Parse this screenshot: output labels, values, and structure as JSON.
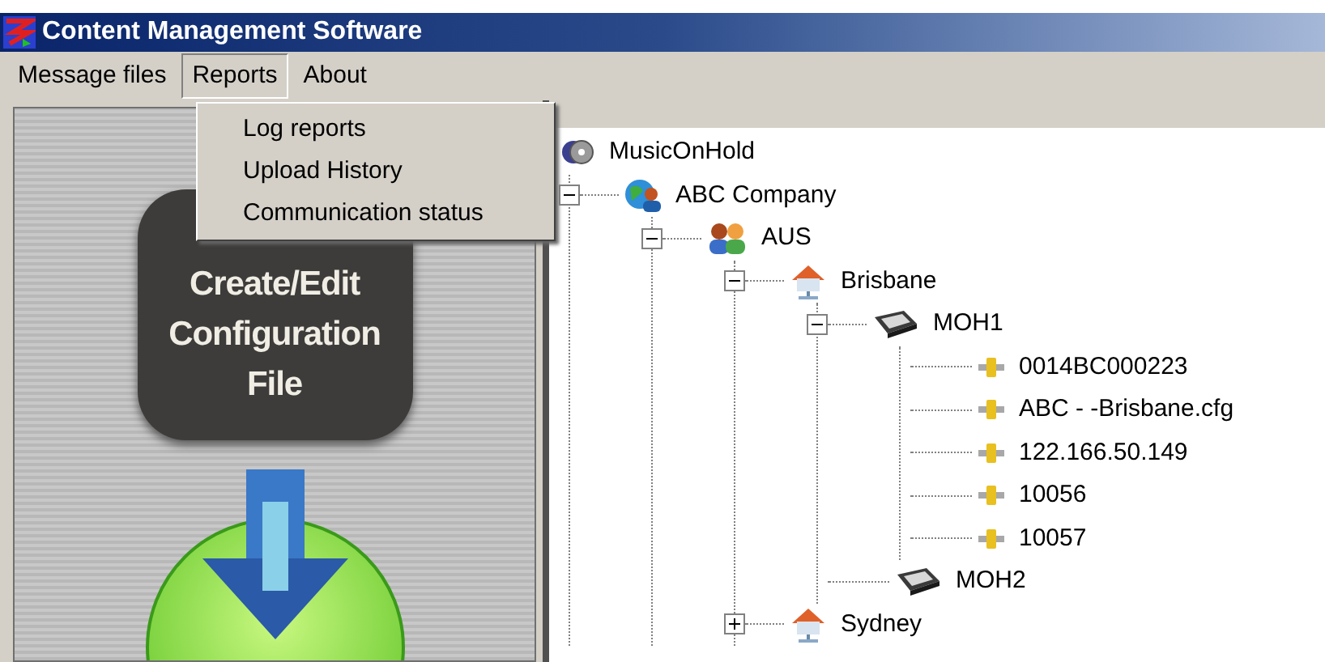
{
  "window": {
    "title": "Content Management Software"
  },
  "menu": [
    {
      "label": "Message files",
      "selected": false
    },
    {
      "label": "Reports",
      "selected": true,
      "items": [
        "Log reports",
        "Upload History",
        "Communication status"
      ]
    },
    {
      "label": "About",
      "selected": false
    }
  ],
  "sidebar": {
    "create_button": {
      "lines": [
        "Create/Edit",
        "Configuration",
        "File"
      ]
    }
  },
  "tree": {
    "label": "MusicOnHold",
    "kind": "root",
    "children": [
      {
        "label": "ABC Company",
        "kind": "company",
        "expanded": true,
        "children": [
          {
            "label": "AUS",
            "kind": "group",
            "expanded": true,
            "children": [
              {
                "label": "Brisbane",
                "kind": "site",
                "expanded": true,
                "children": [
                  {
                    "label": "MOH1",
                    "kind": "device",
                    "expanded": true,
                    "children": [
                      {
                        "label": "0014BC000223",
                        "kind": "property"
                      },
                      {
                        "label": "ABC - -Brisbane.cfg",
                        "kind": "property"
                      },
                      {
                        "label": "122.166.50.149",
                        "kind": "property"
                      },
                      {
                        "label": "10056",
                        "kind": "property"
                      },
                      {
                        "label": "10057",
                        "kind": "property"
                      }
                    ]
                  },
                  {
                    "label": "MOH2",
                    "kind": "device"
                  }
                ]
              },
              {
                "label": "Sydney",
                "kind": "site",
                "expanded": false
              }
            ]
          }
        ]
      }
    ]
  }
}
